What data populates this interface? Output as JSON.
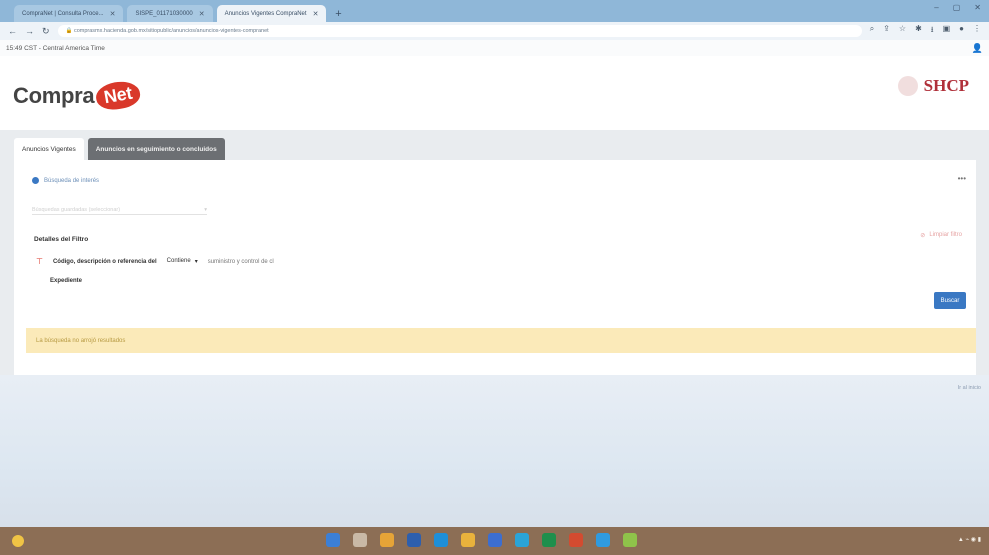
{
  "browser": {
    "tabs": [
      {
        "label": "CompraNet | Consulta Proce...",
        "active": false
      },
      {
        "label": "SISPE_01171030000",
        "active": false
      },
      {
        "label": "Anuncios Vigentes CompraNet",
        "active": true
      }
    ],
    "url": "comprasmx.hacienda.gob.mx/sitiopublic/anuncios/anuncios-vigentes-compranet",
    "clock": "15:49 CST - Central America Time"
  },
  "header": {
    "logo_prefix": "Compra",
    "logo_badge": "Net",
    "agency": "SHCP"
  },
  "tabs": [
    {
      "label": "Anuncios Vigentes",
      "active": true
    },
    {
      "label": "Anuncios en seguimiento o concluidos",
      "active": false
    }
  ],
  "panel": {
    "help_text": "Búsqueda de interés",
    "saved_search_placeholder": "Búsquedas guardadas (seleccionar)",
    "filter_details_title": "Detalles del Filtro",
    "clear_label": "Limpiar filtro",
    "filter": {
      "field": "Código, descripción o referencia del",
      "operator": "Contiene",
      "value": "suministro y control de cl",
      "field_line2": "Expediente"
    },
    "search_button": "Buscar",
    "no_results": "La búsqueda no arrojó resultados"
  },
  "footer_link": "Ir al inicio",
  "colors": {
    "brand_red": "#d9382a",
    "primary_blue": "#3a78c3",
    "warning_bg": "#fbeab9",
    "inactive_tab": "#6c6f73"
  }
}
